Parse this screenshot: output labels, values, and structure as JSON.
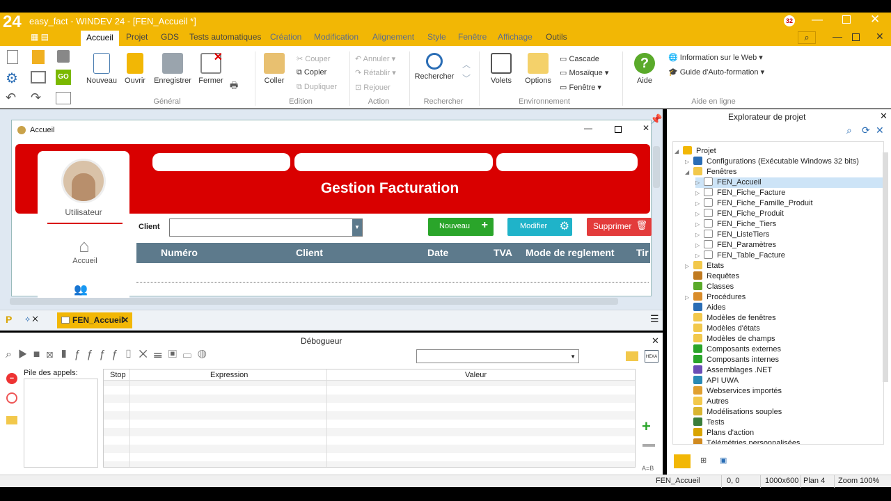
{
  "window": {
    "title": "easy_fact - WINDEV 24 - [FEN_Accueil *]",
    "logo": "24",
    "badge": "32"
  },
  "menu": [
    "Accueil",
    "Projet",
    "GDS",
    "Tests automatiques",
    "Création",
    "Modification",
    "Alignement",
    "Style",
    "Fenêtre",
    "Affichage",
    "Outils"
  ],
  "ribbon": {
    "nouveau": "Nouveau",
    "ouvrir": "Ouvrir",
    "enregistrer": "Enregistrer",
    "fermer": "Fermer",
    "g_general": "Général",
    "coller": "Coller",
    "couper": "Couper",
    "copier": "Copier",
    "dupliquer": "Dupliquer",
    "g_edition": "Edition",
    "annuler": "Annuler",
    "retablir": "Rétablir",
    "rejouer": "Rejouer",
    "g_action": "Action",
    "rechercher": "Rechercher",
    "g_rechercher": "Rechercher",
    "volets": "Volets",
    "options": "Options",
    "cascade": "Cascade",
    "mosaique": "Mosaïque",
    "fenetre": "Fenêtre",
    "g_env": "Environnement",
    "aide": "Aide",
    "info_web": "Information sur le Web",
    "auto_formation": "Guide d'Auto-formation",
    "g_aide": "Aide en ligne"
  },
  "designer": {
    "window_title": "Accueil",
    "app_title": "Gestion Facturation",
    "user_label": "Utilisateur",
    "nav_accueil": "Accueil",
    "client_label": "Client",
    "client_value": "",
    "btn_nouveau": "Nouveau",
    "btn_modifier": "Modifier",
    "btn_supprimer": "Supprimer",
    "columns": [
      "Numéro",
      "Client",
      "Date",
      "TVA",
      "Mode de reglement",
      "Tir"
    ]
  },
  "tabs": {
    "active": "FEN_Accueil"
  },
  "debugger": {
    "title": "Débogueur",
    "calls_label": "Pile des appels:",
    "col_stop": "Stop",
    "col_expression": "Expression",
    "col_valeur": "Valeur",
    "ab_label": "A=B"
  },
  "explorer": {
    "title": "Explorateur de projet",
    "items": [
      {
        "label": "Projet",
        "level": 0,
        "icon": "project-icon"
      },
      {
        "label": "Configurations (Exécutable Windows 32 bits)",
        "level": 1,
        "icon": "gear-icon"
      },
      {
        "label": "Fenêtres",
        "level": 1,
        "icon": "folder-icon"
      },
      {
        "label": "FEN_Accueil",
        "level": 2,
        "icon": "window-icon",
        "selected": true
      },
      {
        "label": "FEN_Fiche_Facture",
        "level": 2,
        "icon": "window-icon"
      },
      {
        "label": "FEN_Fiche_Famille_Produit",
        "level": 2,
        "icon": "window-icon"
      },
      {
        "label": "FEN_Fiche_Produit",
        "level": 2,
        "icon": "window-icon"
      },
      {
        "label": "FEN_Fiche_Tiers",
        "level": 2,
        "icon": "window-icon"
      },
      {
        "label": "FEN_ListeTiers",
        "level": 2,
        "icon": "window-icon"
      },
      {
        "label": "FEN_Paramètres",
        "level": 2,
        "icon": "window-icon"
      },
      {
        "label": "FEN_Table_Facture",
        "level": 2,
        "icon": "window-icon"
      },
      {
        "label": "Etats",
        "level": 1,
        "icon": "folder-icon"
      },
      {
        "label": "Requêtes",
        "level": 1,
        "icon": "query-icon"
      },
      {
        "label": "Classes",
        "level": 1,
        "icon": "class-icon"
      },
      {
        "label": "Procédures",
        "level": 1,
        "icon": "procedure-icon"
      },
      {
        "label": "Aides",
        "level": 1,
        "icon": "help-icon"
      },
      {
        "label": "Modèles de fenêtres",
        "level": 1,
        "icon": "folder-icon"
      },
      {
        "label": "Modèles d'états",
        "level": 1,
        "icon": "folder-icon"
      },
      {
        "label": "Modèles de champs",
        "level": 1,
        "icon": "folder-icon"
      },
      {
        "label": "Composants externes",
        "level": 1,
        "icon": "component-icon"
      },
      {
        "label": "Composants internes",
        "level": 1,
        "icon": "component-icon"
      },
      {
        "label": "Assemblages .NET",
        "level": 1,
        "icon": "dotnet-icon"
      },
      {
        "label": "API UWA",
        "level": 1,
        "icon": "api-icon"
      },
      {
        "label": "Webservices importés",
        "level": 1,
        "icon": "webservice-icon"
      },
      {
        "label": "Autres",
        "level": 1,
        "icon": "folder-icon"
      },
      {
        "label": "Modélisations souples",
        "level": 1,
        "icon": "model-icon"
      },
      {
        "label": "Tests",
        "level": 1,
        "icon": "test-icon"
      },
      {
        "label": "Plans d'action",
        "level": 1,
        "icon": "plan-icon"
      },
      {
        "label": "Télémétries personnalisées",
        "level": 1,
        "icon": "telemetry-icon"
      }
    ]
  },
  "status": {
    "window": "FEN_Accueil",
    "pos": "0, 0",
    "size": "1000x600",
    "plan": "Plan 4",
    "zoom": "Zoom 100%"
  },
  "colors": {
    "accent": "#f2b705",
    "red": "#d90000",
    "green": "#2aa52a",
    "cyan": "#1fb3c9",
    "header": "#5d7a8c"
  }
}
